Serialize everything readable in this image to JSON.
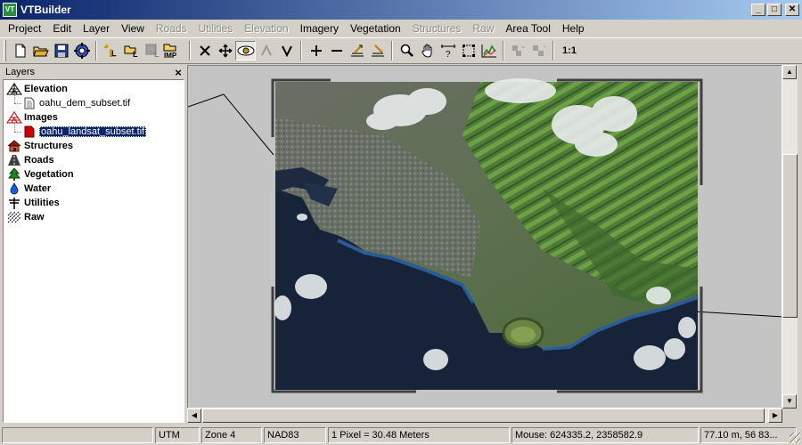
{
  "window": {
    "title": "VTBuilder",
    "buttons": {
      "minimize": "_",
      "maximize": "□",
      "close": "✕"
    }
  },
  "menu": [
    {
      "label": "Project",
      "enabled": true
    },
    {
      "label": "Edit",
      "enabled": true
    },
    {
      "label": "Layer",
      "enabled": true
    },
    {
      "label": "View",
      "enabled": true
    },
    {
      "label": "Roads",
      "enabled": false
    },
    {
      "label": "Utilities",
      "enabled": false
    },
    {
      "label": "Elevation",
      "enabled": false
    },
    {
      "label": "Imagery",
      "enabled": true
    },
    {
      "label": "Vegetation",
      "enabled": true
    },
    {
      "label": "Structures",
      "enabled": false
    },
    {
      "label": "Raw",
      "enabled": false
    },
    {
      "label": "Area Tool",
      "enabled": true
    },
    {
      "label": "Help",
      "enabled": true
    }
  ],
  "toolbar": {
    "zoom_one_to_one": "1:1",
    "imp_label": "IMP"
  },
  "layers_panel": {
    "title": "Layers",
    "close": "×",
    "groups": [
      {
        "label": "Elevation",
        "icon": "elevation-icon",
        "children": [
          "oahu_dem_subset.tif"
        ]
      },
      {
        "label": "Images",
        "icon": "images-icon",
        "children": [
          "oahu_landsat_subset.tif"
        ]
      },
      {
        "label": "Structures",
        "icon": "house-icon",
        "children": []
      },
      {
        "label": "Roads",
        "icon": "road-icon",
        "children": []
      },
      {
        "label": "Vegetation",
        "icon": "tree-icon",
        "children": []
      },
      {
        "label": "Water",
        "icon": "water-drop-icon",
        "children": []
      },
      {
        "label": "Utilities",
        "icon": "utility-pole-icon",
        "children": []
      },
      {
        "label": "Raw",
        "icon": "raw-icon",
        "children": []
      }
    ],
    "selected": "oahu_landsat_subset.tif"
  },
  "status": {
    "projection": "UTM",
    "zone": "Zone 4",
    "datum": "NAD83",
    "pixel_size": "1 Pixel = 30.48 Meters",
    "mouse": "Mouse: 624335.2, 2358582.9",
    "distance": "77.10 m, 56 83..."
  },
  "colors": {
    "title_start": "#0a246a",
    "title_end": "#a6caf0",
    "selection": "#0a246a",
    "ocean": "#16233a",
    "land": "#5c6e4a",
    "vegetation": "#4f8a36"
  }
}
